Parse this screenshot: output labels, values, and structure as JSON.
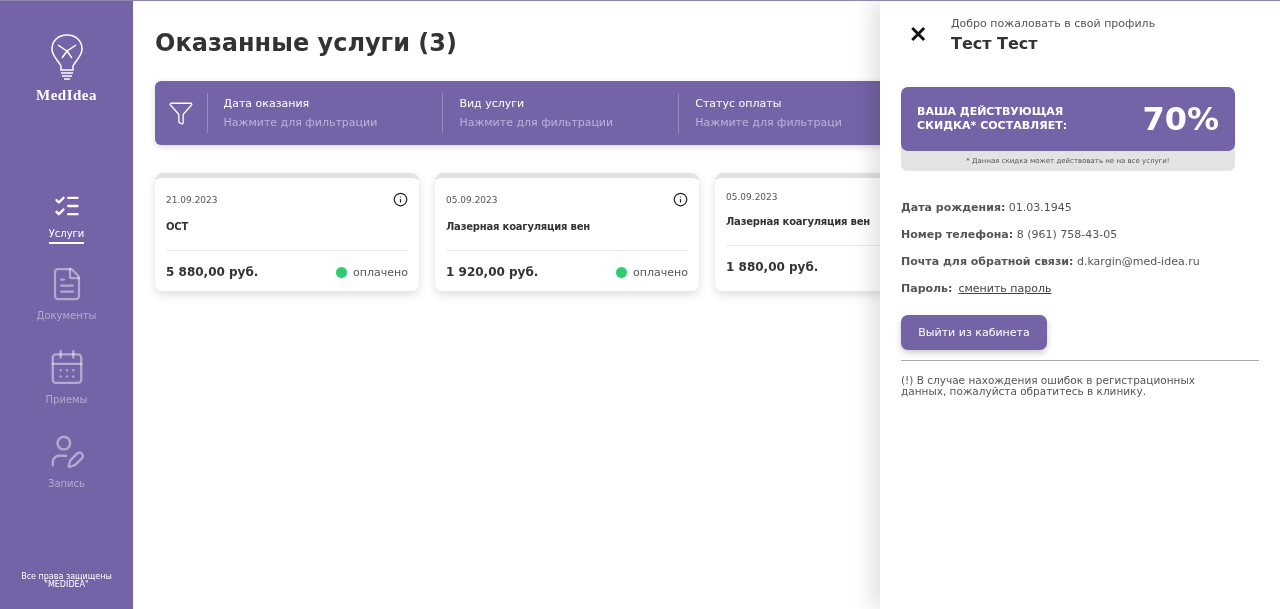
{
  "sidebar": {
    "logo": "MedIdea",
    "items": [
      {
        "kind": "services",
        "label": "Услуги",
        "selected": true
      },
      {
        "kind": "documents",
        "label": "Документы",
        "selected": false
      },
      {
        "kind": "appointments",
        "label": "Приемы",
        "selected": false
      },
      {
        "kind": "booking",
        "label": "Запись",
        "selected": false
      }
    ],
    "footer": [
      "Все права защищены",
      "\"MEDIDEA\""
    ]
  },
  "main": {
    "title": "Оказанные услуги (3)",
    "filters": [
      {
        "label": "Дата оказания",
        "placeholder": "Нажмите для фильтрации"
      },
      {
        "label": "Вид услуги",
        "placeholder": "Нажмите для фильтрации"
      },
      {
        "label": "Статус оплаты",
        "placeholder": "Нажмите для фильтраци"
      }
    ],
    "cards": [
      {
        "date": "21.09.2023",
        "info": true,
        "service": "ОСТ",
        "price": "5 880,00 руб.",
        "status": "оплачено",
        "color": "#2ecc71"
      },
      {
        "date": "05.09.2023",
        "info": true,
        "service": "Лазерная коагуляция вен",
        "price": "1 920,00 руб.",
        "status": "оплачено",
        "color": "#2ecc71"
      },
      {
        "date": "05.09.2023",
        "info": false,
        "service": "Лазерная коагуляция вен",
        "price": "1 880,00 руб."
      }
    ]
  },
  "profile": {
    "close": "✕",
    "greeting": "Добро пожаловать в свой профиль",
    "name": "Тест Тест",
    "discount": {
      "label": [
        "ВАША ДЕЙСТВУЮЩАЯ",
        "СКИДКА* СОСТАВЛЯЕТ:"
      ],
      "value": "70%",
      "note": "* Данная скидка может действовать не на все услуги!"
    },
    "fields": [
      {
        "label": "Дата рождения:",
        "value": "01.03.1945"
      },
      {
        "label": "Номер телефона:",
        "value": "8 (961) 758-43-05"
      },
      {
        "label": "Почта для обратной связи:",
        "value": "d.kargin@med-idea.ru"
      },
      {
        "label": "Пароль:",
        "link": "сменить пароль"
      }
    ],
    "logout": "Выйти из кабинета",
    "notice": "(!) В случае нахождения ошибок в регистрационных данных, пожалуйста обратитесь в клинику."
  }
}
